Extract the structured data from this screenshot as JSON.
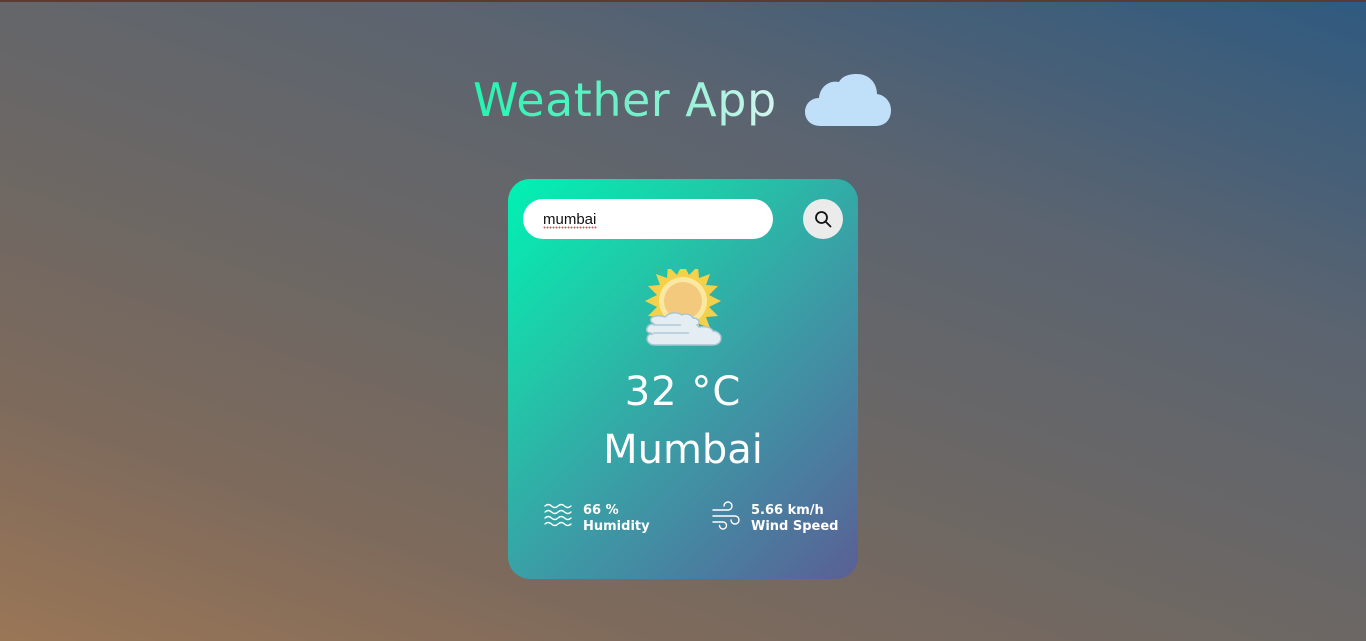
{
  "header": {
    "title": "Weather App",
    "icon": "cloud-icon"
  },
  "search": {
    "value": "mumbai",
    "button_icon": "search-icon"
  },
  "weather": {
    "icon": "partly-cloudy-sun-icon",
    "temperature": "32 °C",
    "city": "Mumbai"
  },
  "details": {
    "humidity": {
      "icon": "humidity-waves-icon",
      "value": "66 %",
      "label": "Humidity"
    },
    "wind": {
      "icon": "wind-icon",
      "value": "5.66 km/h",
      "label": "Wind Speed"
    }
  },
  "colors": {
    "card_gradient_start": "#00f2b4",
    "card_gradient_end": "#5a5f94",
    "title_gradient_start": "#22f5b0",
    "title_gradient_end": "#d4f5f0"
  }
}
